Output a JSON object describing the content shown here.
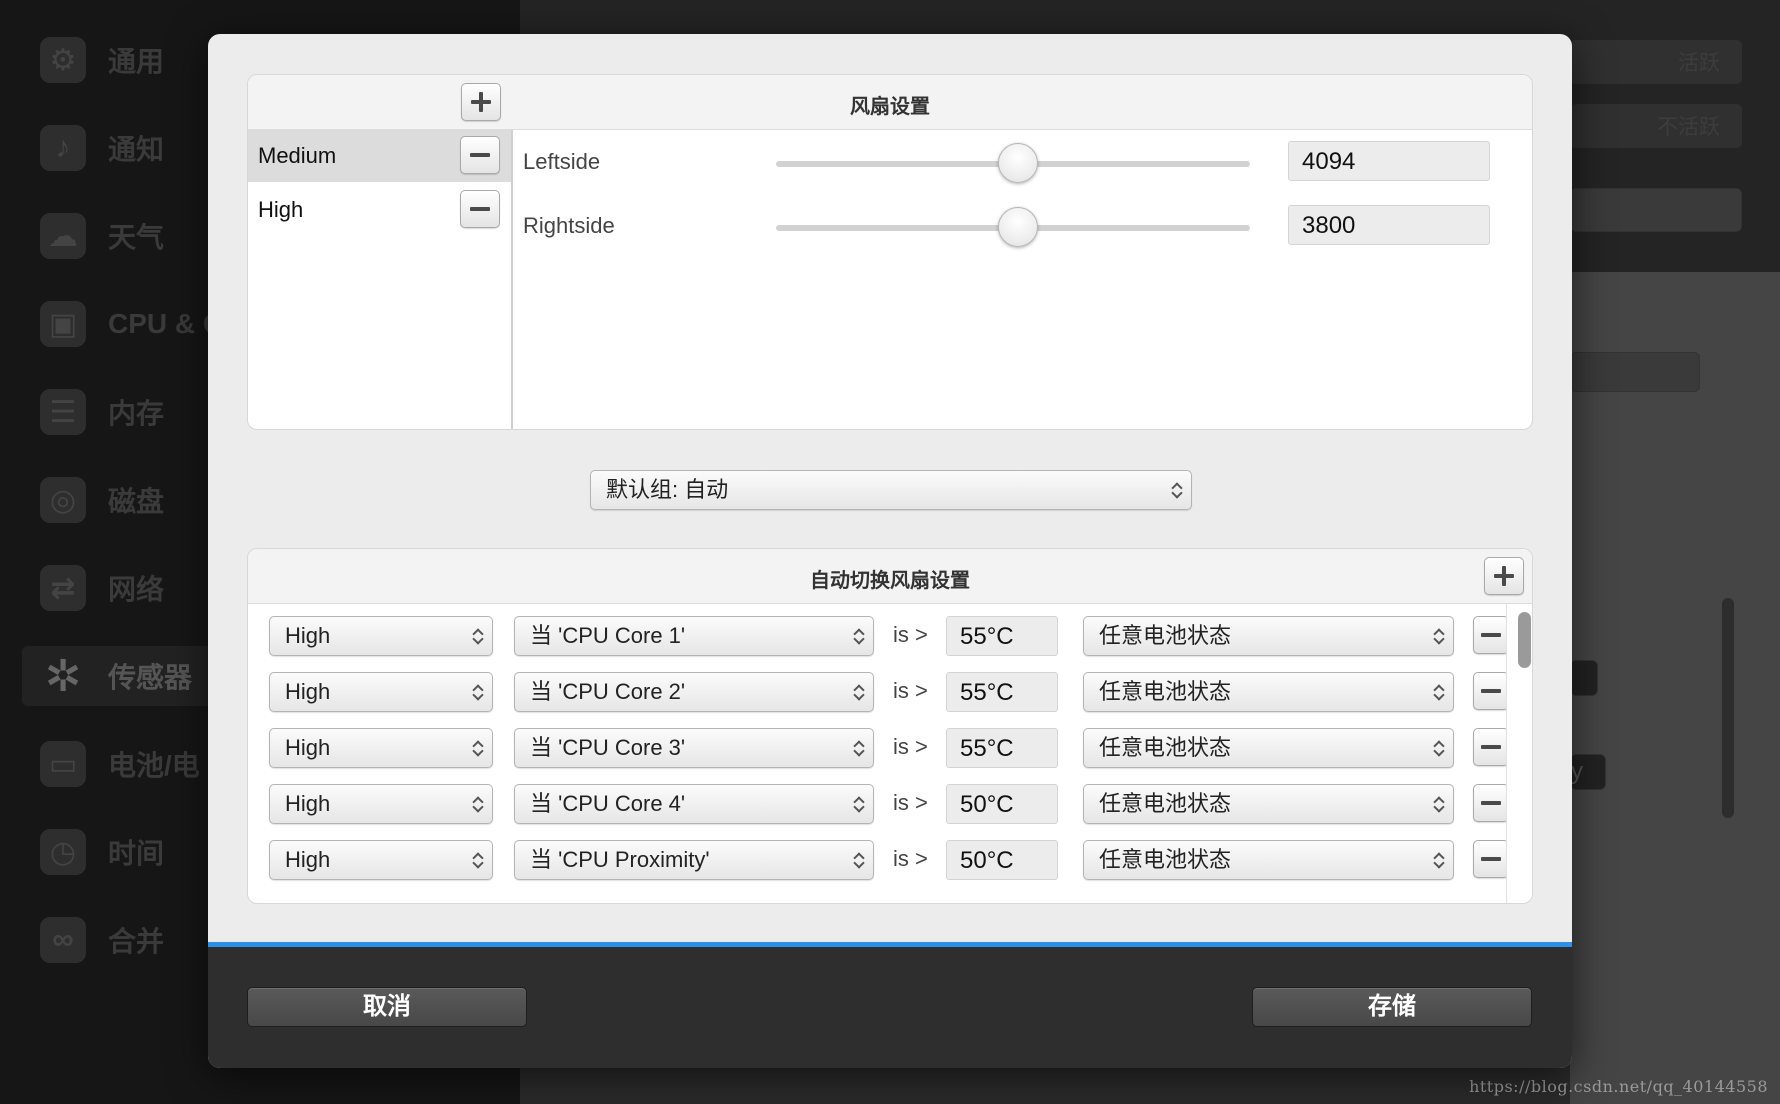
{
  "background": {
    "sidebar": [
      {
        "label": "通用",
        "icon": "gear-icon"
      },
      {
        "label": "通知",
        "icon": "bell-icon"
      },
      {
        "label": "天气",
        "icon": "weather-icon"
      },
      {
        "label": "CPU & G",
        "icon": "cpu-icon"
      },
      {
        "label": "内存",
        "icon": "memory-icon"
      },
      {
        "label": "磁盘",
        "icon": "disk-icon"
      },
      {
        "label": "网络",
        "icon": "network-icon"
      },
      {
        "label": "传感器",
        "icon": "fan-icon"
      },
      {
        "label": "电池/电",
        "icon": "battery-icon"
      },
      {
        "label": "时间",
        "icon": "clock-icon"
      },
      {
        "label": "合并",
        "icon": "merge-icon"
      }
    ],
    "pill_active": "活跃",
    "pill_inactive": "不活跃",
    "partial_text": "y"
  },
  "fan_settings": {
    "title": "风扇设置",
    "presets": [
      {
        "name": "Medium",
        "selected": true
      },
      {
        "name": "High",
        "selected": false
      }
    ],
    "fans": [
      {
        "label": "Leftside",
        "value": "4094",
        "slider_fraction": 0.51
      },
      {
        "label": "Rightside",
        "value": "3800",
        "slider_fraction": 0.51
      }
    ]
  },
  "default_group": {
    "value": "默认组: 自动"
  },
  "auto_switch": {
    "title": "自动切换风扇设置",
    "rules": [
      {
        "preset": "High",
        "sensor": "当 'CPU Core 1'",
        "operator": "is >",
        "temp": "55°C",
        "battery": "任意电池状态"
      },
      {
        "preset": "High",
        "sensor": "当 'CPU Core 2'",
        "operator": "is >",
        "temp": "55°C",
        "battery": "任意电池状态"
      },
      {
        "preset": "High",
        "sensor": "当 'CPU Core 3'",
        "operator": "is >",
        "temp": "55°C",
        "battery": "任意电池状态"
      },
      {
        "preset": "High",
        "sensor": "当 'CPU Core 4'",
        "operator": "is >",
        "temp": "50°C",
        "battery": "任意电池状态"
      },
      {
        "preset": "High",
        "sensor": "当 'CPU Proximity'",
        "operator": "is >",
        "temp": "50°C",
        "battery": "任意电池状态"
      }
    ]
  },
  "footer": {
    "cancel": "取消",
    "save": "存储"
  },
  "colors": {
    "accent": "#2d8fe6",
    "footer_bg": "#2e2e2e",
    "panel_bg": "#ffffff",
    "modal_bg": "#ececec"
  },
  "watermark": "https://blog.csdn.net/qq_40144558"
}
